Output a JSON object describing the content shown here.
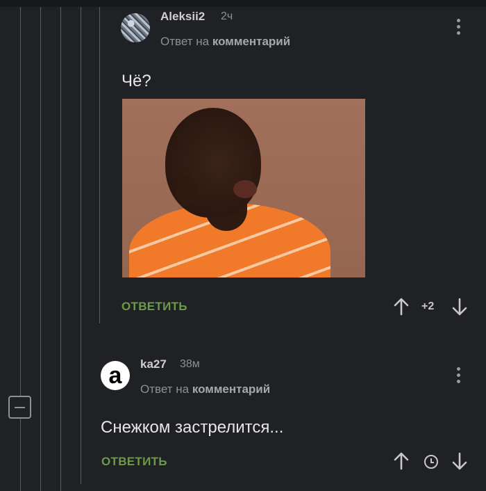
{
  "comments": [
    {
      "username": "Aleksii2",
      "time": "2ч",
      "reply_prefix": "Ответ на",
      "reply_target": "комментарий",
      "text": "Чё?",
      "reply_label": "ОТВЕТИТЬ",
      "score": "+2"
    },
    {
      "username": "ka27",
      "time": "38м",
      "avatar_letter": "a",
      "reply_prefix": "Ответ на",
      "reply_target": "комментарий",
      "text": "Снежком застрелится...",
      "reply_label": "ОТВЕТИТЬ"
    }
  ],
  "colors": {
    "background": "#202124",
    "reply_green": "#6b9b48",
    "muted_text": "#8e9095"
  }
}
